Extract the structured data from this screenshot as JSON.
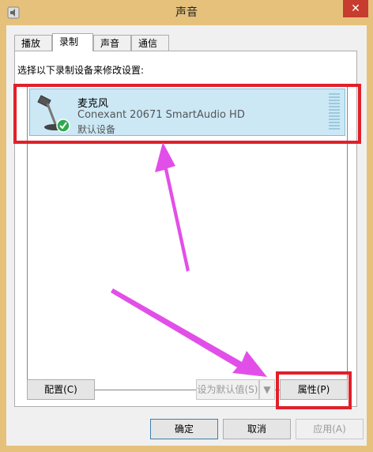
{
  "window": {
    "title": "声音",
    "close_label": "✕"
  },
  "tabs": [
    {
      "label": "播放"
    },
    {
      "label": "录制"
    },
    {
      "label": "声音"
    },
    {
      "label": "通信"
    }
  ],
  "panel": {
    "instruction": "选择以下录制设备来修改设置:"
  },
  "devices": [
    {
      "name": "麦克风",
      "description": "Conexant 20671 SmartAudio HD",
      "status": "默认设备",
      "icon": "microphone-icon"
    }
  ],
  "buttons": {
    "configure": "配置(C)",
    "set_default": "设为默认值(S)",
    "dropdown": "▼",
    "properties": "属性(P)",
    "ok": "确定",
    "cancel": "取消",
    "apply": "应用(A)"
  },
  "colors": {
    "highlight": "#e0202a",
    "arrow": "#e24fe8",
    "title_bar": "#e6c17c",
    "selection": "#cce8f5"
  }
}
